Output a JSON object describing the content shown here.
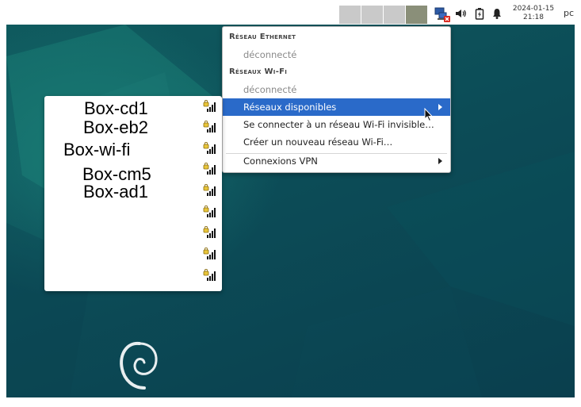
{
  "panel": {
    "clock_date": "2024-01-15",
    "clock_time": "21:18",
    "user": "pc",
    "tray_icons": [
      "network-disconnected-icon",
      "volume-icon",
      "battery-icon",
      "notification-bell-icon"
    ]
  },
  "network_menu": {
    "ethernet_header": "Réseau Ethernet",
    "ethernet_status": "déconnecté",
    "wifi_header": "Réseaux Wi-Fi",
    "wifi_status": "déconnecté",
    "available_networks": "Réseaux disponibles",
    "connect_hidden": "Se connecter à un réseau Wi-Fi invisible…",
    "create_new": "Créer un nouveau réseau Wi-Fi…",
    "vpn": "Connexions VPN"
  },
  "available_networks_list": {
    "networks": [
      "Box-cd1",
      "Box-eb2",
      "Box-wi-fi",
      "Box-cm5",
      "Box-ad1",
      "",
      "",
      "",
      ""
    ],
    "signal_icon": "wifi-locked-signal-icon"
  },
  "colors": {
    "desktop": "#0d4d56",
    "selection": "#2a6ac9"
  }
}
